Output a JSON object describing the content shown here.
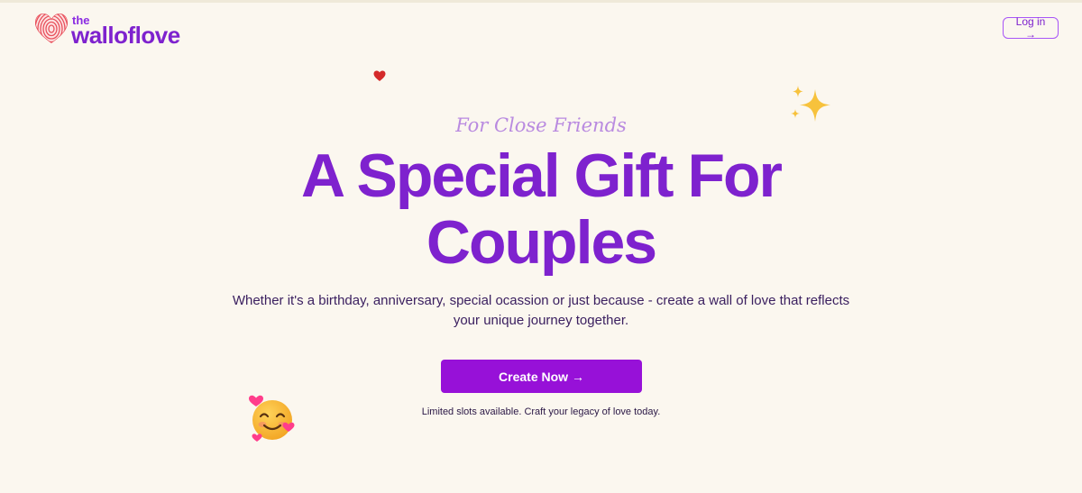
{
  "brand": {
    "prefix": "the",
    "name": "walloflove",
    "accent_color": "#7e22ce"
  },
  "header": {
    "login_label": "Log in →"
  },
  "hero": {
    "eyebrow": "For Close Friends",
    "headline": "A Special Gift For Couples",
    "description": "Whether it's a birthday, anniversary, special ocassion or just because - create a wall of love that reflects your unique journey together.",
    "cta_label": "Create Now →",
    "note": "Limited slots available. Craft your legacy of love today."
  },
  "icons": {
    "logo": "heart-fingerprint-icon",
    "decoration_1": "red-heart-icon",
    "decoration_2": "sparkles-icon",
    "decoration_3": "smiling-face-with-hearts-icon"
  },
  "colors": {
    "background": "#fbf7ef",
    "primary": "#7e22ce",
    "cta": "#9711d8",
    "eyebrow": "#b98ae0",
    "logo_heart": "#e8505b"
  }
}
